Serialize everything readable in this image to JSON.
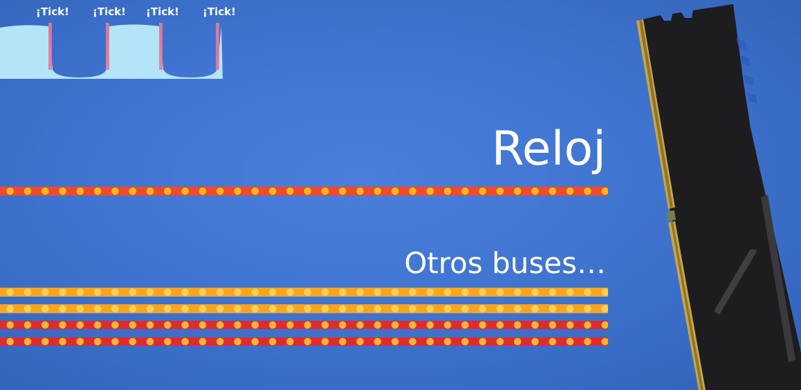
{
  "clock_diagram": {
    "ticks": [
      "¡Tick!",
      "¡Tick!",
      "¡Tick!",
      "¡Tick!"
    ]
  },
  "labels": {
    "clock": "Reloj",
    "other_buses": "Otros buses…"
  },
  "colors": {
    "background": "#3f74d0",
    "clock_bus": "#ee4a2e",
    "yellow_bus": "#f6a521",
    "red_bus": "#e02a2e",
    "bus_dot": "#f9b820",
    "ram_module": "#1d1d1f",
    "ram_pins": "#c7a548"
  },
  "icons": {
    "ram": "ram-module-icon"
  }
}
